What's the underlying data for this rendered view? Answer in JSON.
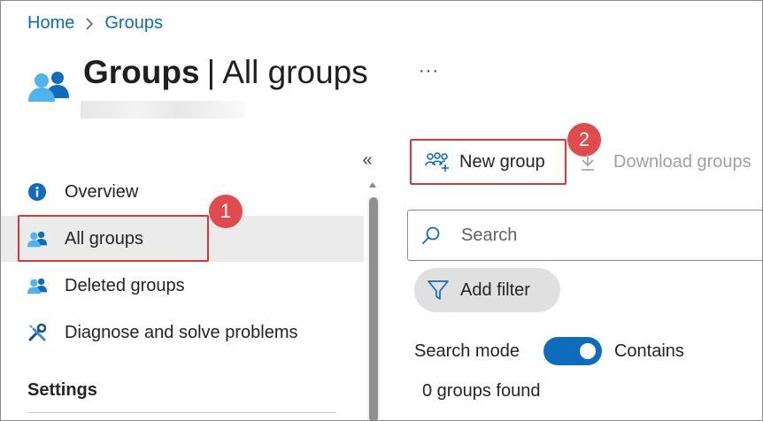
{
  "breadcrumb": {
    "home": "Home",
    "current": "Groups"
  },
  "header": {
    "title_main": "Groups",
    "title_sep": "|",
    "title_sub": "All groups",
    "more": "···"
  },
  "sidebar": {
    "collapse": "«",
    "items": [
      {
        "label": "Overview",
        "icon": "info-icon"
      },
      {
        "label": "All groups",
        "icon": "groups-icon",
        "active": true
      },
      {
        "label": "Deleted groups",
        "icon": "groups-icon"
      },
      {
        "label": "Diagnose and solve problems",
        "icon": "wrench-screwdriver-icon"
      }
    ],
    "settings_heading": "Settings"
  },
  "toolbar": {
    "new_group": "New group",
    "download_groups": "Download groups"
  },
  "search": {
    "placeholder": "Search"
  },
  "filter": {
    "add_filter": "Add filter"
  },
  "search_mode": {
    "label": "Search mode",
    "value": "Contains",
    "enabled": true
  },
  "results": {
    "count_text": "0 groups found"
  },
  "annotations": {
    "step1": "1",
    "step2": "2"
  },
  "colors": {
    "accent": "#0f6cbd",
    "highlight": "#d9383b",
    "badge": "#e04b4e"
  }
}
